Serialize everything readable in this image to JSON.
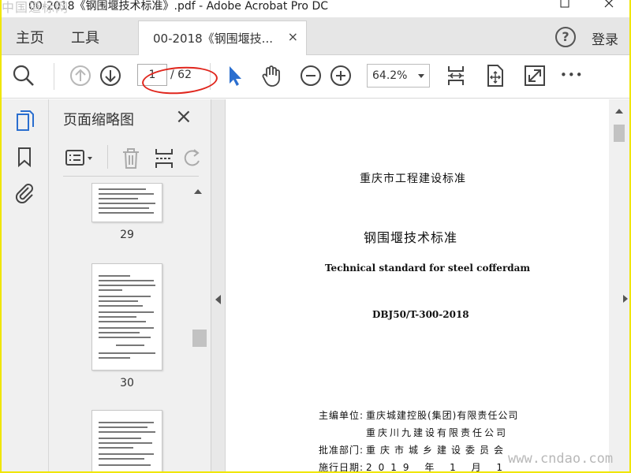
{
  "window": {
    "title": "00-2018《钢围堰技术标准》.pdf - Adobe Acrobat Pro DC",
    "watermark_logo": "中国道标网",
    "maximize_icon": "maximize-icon",
    "close_icon": "close-icon"
  },
  "menu": {
    "home": "主页",
    "tools": "工具",
    "tab_label": "00-2018《钢围堰技...",
    "tab_close": "×",
    "help": "?",
    "signin": "登录"
  },
  "toolbar": {
    "page_current": "1",
    "page_total": "/ 62",
    "zoom": "64.2%",
    "more": "•••",
    "annotation_color": "#e0261d"
  },
  "thumbs": {
    "title": "页面缩略图",
    "close": "×",
    "pages": [
      {
        "label": "29"
      },
      {
        "label": "30"
      }
    ]
  },
  "document": {
    "line1": "重庆市工程建设标准",
    "line2": "钢围堰技术标准",
    "line3": "Technical standard for steel cofferdam",
    "line4": "DBJ50/T-300-2018",
    "editor_label": "主编单位:",
    "editor1": "重庆城建控股(集团)有限责任公司",
    "editor2": "重庆川九建设有限责任公司",
    "approver_label": "批准部门:",
    "approver": "重庆市城乡建设委员会",
    "date_label": "施行日期:",
    "date": "2019 年 1 月 1"
  },
  "site_watermark": "www.cndao.com",
  "colors": {
    "frame_border": "#f0e600",
    "accent_blue": "#2a6ecf"
  }
}
